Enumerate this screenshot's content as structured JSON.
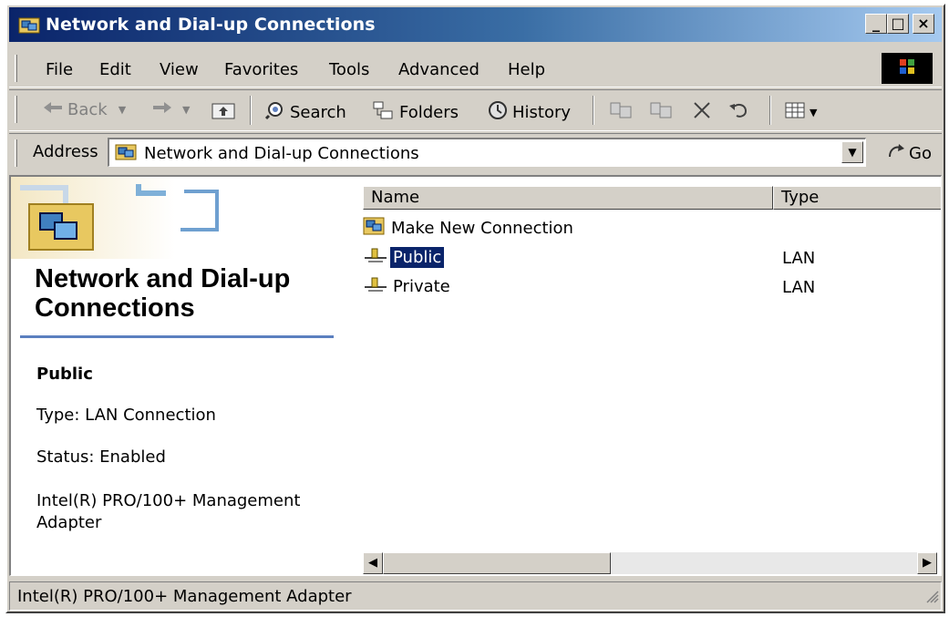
{
  "window": {
    "title": "Network and Dial-up Connections"
  },
  "title_buttons": {
    "minimize": "_",
    "maximize": "□",
    "close": "×"
  },
  "menu": [
    "File",
    "Edit",
    "View",
    "Favorites",
    "Tools",
    "Advanced",
    "Help"
  ],
  "toolbar": {
    "back": "Back",
    "search": "Search",
    "folders": "Folders",
    "history": "History"
  },
  "address": {
    "label": "Address",
    "value": "Network and Dial-up Connections",
    "go": "Go"
  },
  "left_pane": {
    "title": "Network and Dial-up Connections",
    "selected_name": "Public",
    "type_line": "Type: LAN Connection",
    "status_line": "Status: Enabled",
    "device_line": "Intel(R) PRO/100+ Management Adapter"
  },
  "list": {
    "columns": [
      "Name",
      "Type"
    ],
    "items": [
      {
        "name": "Make New Connection",
        "type": "",
        "icon": "make-new-connection-icon"
      },
      {
        "name": "Public",
        "type": "LAN",
        "icon": "lan-connection-icon",
        "selected": true
      },
      {
        "name": "Private",
        "type": "LAN",
        "icon": "lan-connection-icon"
      }
    ]
  },
  "status_bar": {
    "text": "Intel(R) PRO/100+ Management Adapter"
  },
  "colors": {
    "title_start": "#0a246a",
    "title_end": "#a6caf0",
    "selection": "#0a246a",
    "face": "#d4d0c8"
  }
}
